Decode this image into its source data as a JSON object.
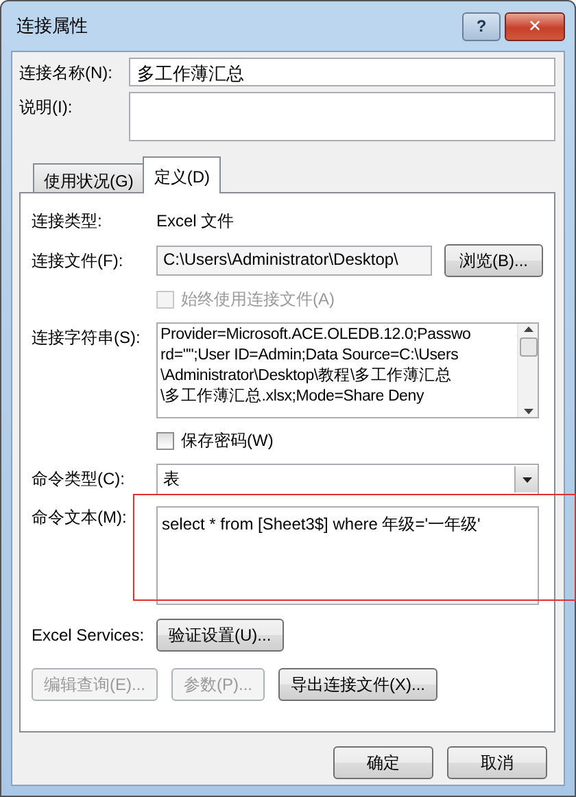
{
  "window": {
    "title": "连接属性",
    "help_button": "?",
    "close_button": "✕"
  },
  "connection_name": {
    "label": "连接名称(N):",
    "value": "多工作薄汇总"
  },
  "description": {
    "label": "说明(I):"
  },
  "tabs": [
    {
      "label": "使用状况(G)",
      "selected": false
    },
    {
      "label": "定义(D)",
      "selected": true
    }
  ],
  "definition": {
    "connection_type": {
      "label": "连接类型:",
      "value": "Excel 文件"
    },
    "connection_file": {
      "label": "连接文件(F):",
      "value": "C:\\Users\\Administrator\\Desktop\\",
      "button": "浏览(B)..."
    },
    "always_use_file": {
      "label": "始终使用连接文件(A)",
      "checked": false,
      "disabled": true
    },
    "connection_string": {
      "label": "连接字符串(S):",
      "lines": [
        "Provider=Microsoft.ACE.OLEDB.12.0;Passwo",
        "rd=\"\";User ID=Admin;Data Source=C:\\Users",
        "\\Administrator\\Desktop\\教程\\多工作薄汇总",
        "\\多工作薄汇总.xlsx;Mode=Share Deny"
      ]
    },
    "save_password": {
      "label": "保存密码(W)",
      "checked": false,
      "disabled": false
    },
    "command_type": {
      "label": "命令类型(C):",
      "value": "表"
    },
    "command_text": {
      "label": "命令文本(M):",
      "value": "select * from [Sheet3$] where 年级='一年级'",
      "highlighted": true
    },
    "excel_services": {
      "label": "Excel Services:",
      "button": "验证设置(U)..."
    },
    "buttons": [
      {
        "label": "编辑查询(E)...",
        "disabled": true
      },
      {
        "label": "参数(P)...",
        "disabled": true
      },
      {
        "label": "导出连接文件(X)...",
        "disabled": false
      }
    ]
  },
  "footer_buttons": [
    "确定",
    "取消"
  ]
}
